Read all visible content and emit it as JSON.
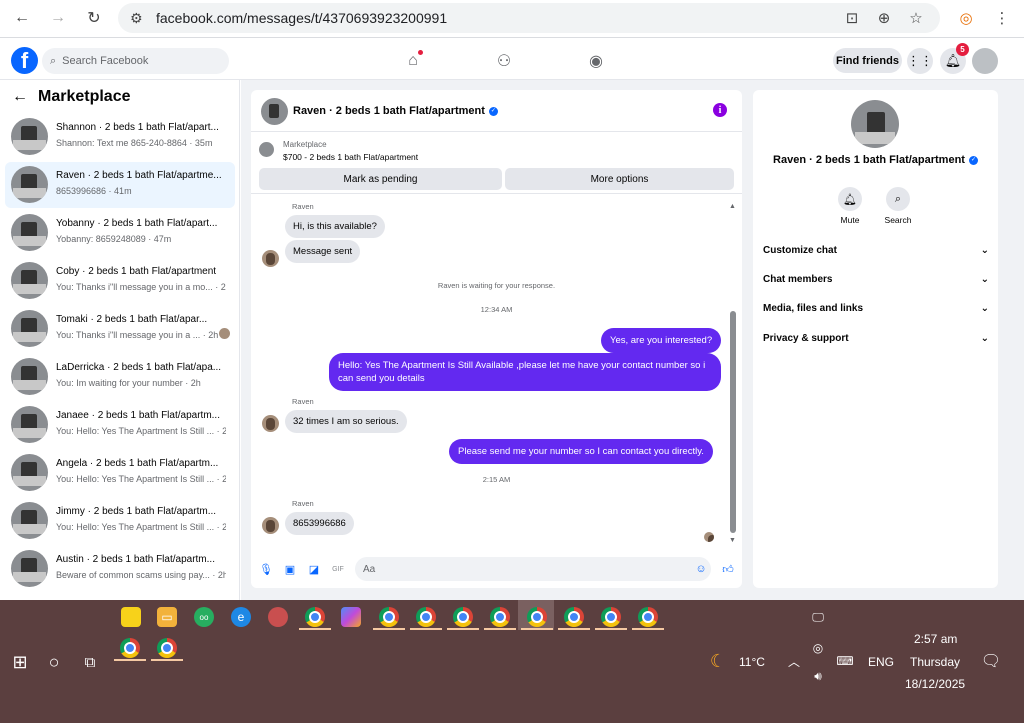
{
  "browser": {
    "url": "facebook.com/messages/t/4370693923200991"
  },
  "fb": {
    "search_placeholder": "Search Facebook",
    "find_friends": "Find friends",
    "notif_count": "5"
  },
  "sidebar": {
    "title": "Marketplace",
    "conversations": [
      {
        "title": "Shannon · 2 beds 1 bath Flat/apart...",
        "sub": "Shannon: Text me 865-240-8864 · 35m"
      },
      {
        "title": "Raven · 2 beds 1 bath Flat/apartme...",
        "sub": "8653996686 · 41m"
      },
      {
        "title": "Yobanny · 2 beds 1 bath Flat/apart...",
        "sub": "Yobanny: 8659248089 · 47m"
      },
      {
        "title": "Coby · 2 beds 1 bath Flat/apartment",
        "sub": "You: Thanks i\"ll message you in a mo... · 2h"
      },
      {
        "title": "Tomaki · 2 beds 1 bath Flat/apar...",
        "sub": "You: Thanks i\"ll message you in a ... · 2h"
      },
      {
        "title": "LaDerricka · 2 beds 1 bath Flat/apa...",
        "sub": "You: Im waiting for your number · 2h"
      },
      {
        "title": "Janaee · 2 beds 1 bath Flat/apartm...",
        "sub": "You: Hello: Yes The Apartment Is Still ... · 2h"
      },
      {
        "title": "Angela · 2 beds 1 bath Flat/apartm...",
        "sub": "You: Hello: Yes The Apartment Is Still ... · 2h"
      },
      {
        "title": "Jimmy · 2 beds 1 bath Flat/apartm...",
        "sub": "You: Hello: Yes The Apartment Is Still ... · 2h"
      },
      {
        "title": "Austin · 2 beds 1 bath Flat/apartm...",
        "sub": "Beware of common scams using pay... · 2h"
      }
    ]
  },
  "chat": {
    "name": "Raven · 2 beds 1 bath Flat/apartment",
    "marketplace_label": "Marketplace",
    "listing": "$700 - 2 beds 1 bath Flat/apartment",
    "btn_pending": "Mark as pending",
    "btn_more": "More options",
    "sender": "Raven",
    "msg1": "Hi, is this available?",
    "msg2": "Message sent",
    "waiting": "Raven is waiting for your response.",
    "time1": "12:34 AM",
    "out1": "Yes, are you interested?",
    "out2": "Hello: Yes The Apartment Is Still Available ,please let me have your contact number so i can send you details",
    "msg3": "32 times I am so serious.",
    "out3": "Please send me your number so I can contact you directly.",
    "time2": "2:15 AM",
    "msg4": "8653996686",
    "input_placeholder": "Aa"
  },
  "rpanel": {
    "name": "Raven · 2 beds 1 bath Flat/apartment",
    "mute": "Mute",
    "search": "Search",
    "rows": [
      "Customize chat",
      "Chat members",
      "Media, files and links",
      "Privacy & support"
    ]
  },
  "taskbar": {
    "temp": "11°C",
    "lang": "ENG",
    "time": "2:57 am",
    "day": "Thursday",
    "date": "18/12/2025"
  }
}
